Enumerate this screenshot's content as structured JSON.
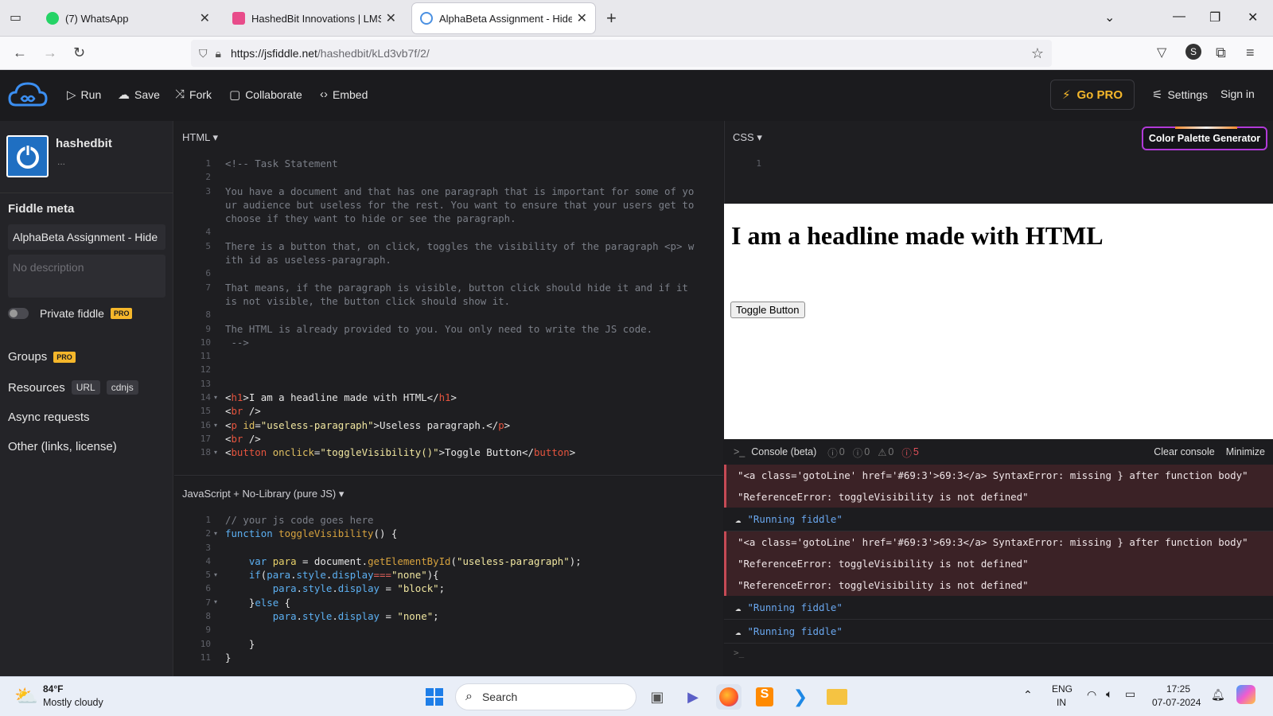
{
  "browser": {
    "tabs": [
      {
        "title": "(7) WhatsApp",
        "active": false
      },
      {
        "title": "HashedBit Innovations | LMS",
        "active": false
      },
      {
        "title": "AlphaBeta Assignment - Hide S",
        "active": true
      }
    ],
    "url_host": "https://jsfiddle.net",
    "url_path": "/hashedbit/kLd3vb7f/2/"
  },
  "toolbar": {
    "run": "Run",
    "save": "Save",
    "fork": "Fork",
    "collaborate": "Collaborate",
    "embed": "Embed",
    "go_pro": "Go PRO",
    "settings": "Settings",
    "sign_in": "Sign in"
  },
  "sidebar": {
    "username": "hashedbit",
    "user_sub": "...",
    "fiddle_meta": "Fiddle meta",
    "title_value": "AlphaBeta Assignment - Hide",
    "description_placeholder": "No description",
    "private_label": "Private fiddle",
    "pro_badge": "PRO",
    "groups": "Groups",
    "resources": "Resources",
    "resources_tags": [
      "URL",
      "cdnjs"
    ],
    "async_requests": "Async requests",
    "other": "Other (links, license)"
  },
  "html_panel": {
    "label": "HTML ▾",
    "line_numbers": [
      "1",
      "2",
      "3",
      "",
      "",
      "4",
      "5",
      "",
      "6",
      "7",
      "",
      "8",
      "9",
      "10",
      "11",
      "12",
      "13",
      "14",
      "15",
      "16",
      "17",
      "18"
    ],
    "lines": [
      "<!-- Task Statement",
      "",
      "You have a document and that has one paragraph that is important for some of yo",
      "ur audience but useless for the rest. You want to ensure that your users get to",
      "choose if they want to hide or see the paragraph.",
      "",
      "There is a button that, on click, toggles the visibility of the paragraph <p> w",
      "ith id as useless-paragraph.",
      "",
      "That means, if the paragraph is visible, button click should hide it and if it",
      "is not visible, the button click should show it.",
      "",
      "The HTML is already provided to you. You only need to write the JS code.",
      " -->"
    ]
  },
  "css_panel": {
    "label": "CSS ▾",
    "line1": "1",
    "color_palette": "Color Palette Generator"
  },
  "js_panel": {
    "label": "JavaScript + No-Library (pure JS) ▾"
  },
  "result": {
    "headline": "I am a headline made with HTML",
    "button": "Toggle Button"
  },
  "console": {
    "title": "Console (beta)",
    "counts": [
      "0",
      "0",
      "0",
      "5"
    ],
    "clear": "Clear console",
    "minimize": "Minimize",
    "entries": [
      {
        "type": "error",
        "text": "\"<a class='gotoLine' href='#69:3'>69:3</a> SyntaxError: missing } after function body\""
      },
      {
        "type": "error",
        "text": "\"ReferenceError: toggleVisibility is not defined\""
      },
      {
        "type": "info",
        "text": "\"Running fiddle\""
      },
      {
        "type": "error",
        "text": "\"<a class='gotoLine' href='#69:3'>69:3</a> SyntaxError: missing } after function body\""
      },
      {
        "type": "error",
        "text": "\"ReferenceError: toggleVisibility is not defined\""
      },
      {
        "type": "error",
        "text": "\"ReferenceError: toggleVisibility is not defined\""
      },
      {
        "type": "info",
        "text": "\"Running fiddle\""
      },
      {
        "type": "info",
        "text": "\"Running fiddle\""
      }
    ],
    "prompt": ">_"
  },
  "taskbar": {
    "temp": "84°F",
    "weather": "Mostly cloudy",
    "search": "Search",
    "lang1": "ENG",
    "lang2": "IN",
    "time": "17:25",
    "date": "07-07-2024"
  },
  "colors": {
    "accent": "#f5b72b",
    "error_bg": "#3b2226",
    "info": "#6aa8f0"
  }
}
